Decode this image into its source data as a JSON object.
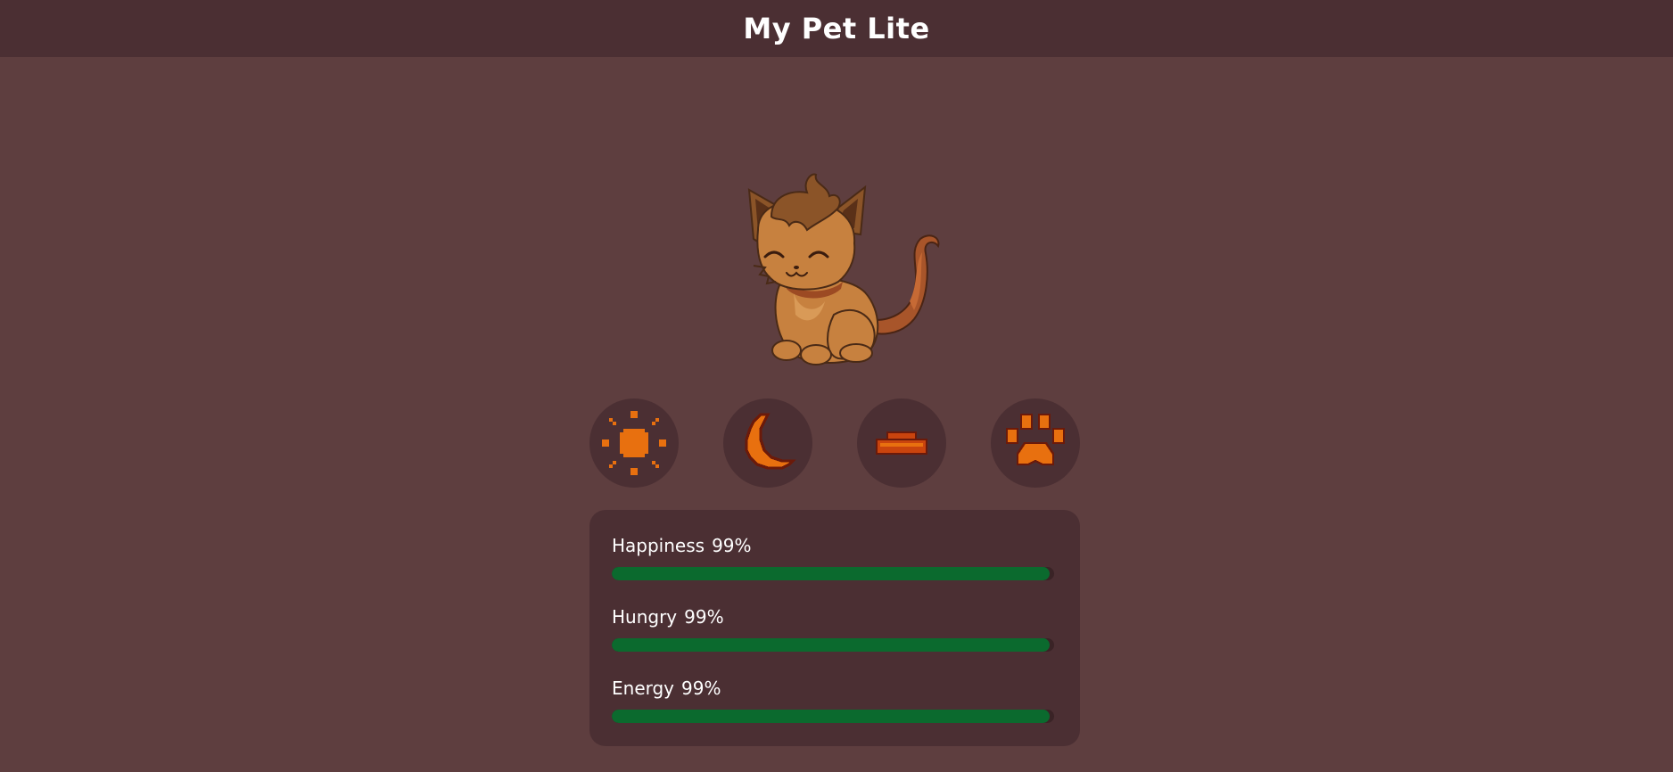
{
  "app": {
    "title": "My Pet Lite"
  },
  "pet": {
    "icon": "cat-pet-illustration"
  },
  "actions": [
    {
      "icon": "sun-icon",
      "name": "wake"
    },
    {
      "icon": "moon-icon",
      "name": "sleep"
    },
    {
      "icon": "food-bowl-icon",
      "name": "feed"
    },
    {
      "icon": "paw-icon",
      "name": "play"
    }
  ],
  "stats": [
    {
      "label": "Happiness",
      "value_text": "99%",
      "value": 0.99
    },
    {
      "label": "Hungry",
      "value_text": "99%",
      "value": 0.99
    },
    {
      "label": "Energy",
      "value_text": "99%",
      "value": 0.99
    }
  ],
  "colors": {
    "background": "#5e3e3f",
    "header": "#4b2f33",
    "panel": "#4b2f33",
    "bar_fill": "#0b6a2e",
    "icon_orange": "#e8700f",
    "icon_outline": "#6b1a0a"
  }
}
